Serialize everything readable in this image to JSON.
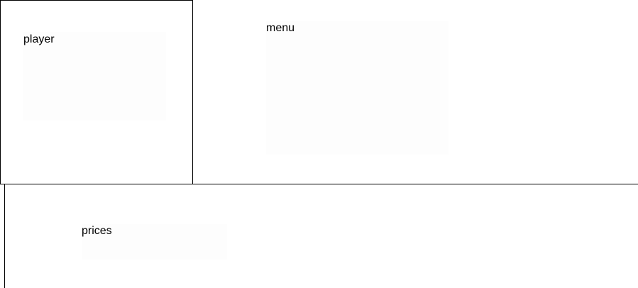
{
  "player": {
    "label": "player"
  },
  "menu": {
    "label": "menu"
  },
  "prices": {
    "label": "prices"
  }
}
